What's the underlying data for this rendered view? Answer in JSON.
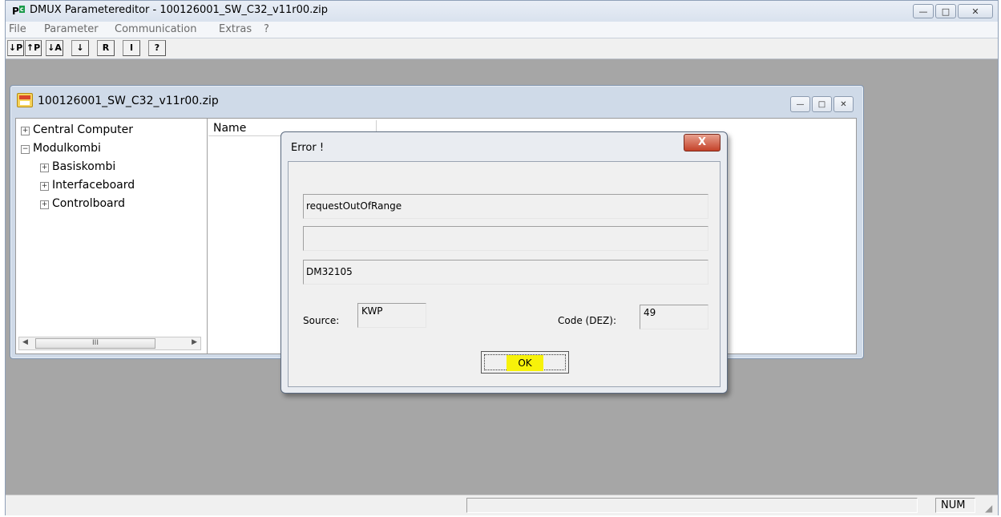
{
  "app": {
    "title": "DMUX Parametereditor - 100126001_SW_C32_v11r00.zip",
    "icon": "app-p-icon"
  },
  "window_buttons": {
    "minimize": "—",
    "maximize": "□",
    "close": "✕"
  },
  "menu": [
    "File",
    "Parameter",
    "Communication",
    "Extras",
    "?"
  ],
  "toolbar": [
    "↓P",
    "↑P",
    "↓A",
    "↓",
    "R",
    "I",
    "?"
  ],
  "document": {
    "title": "100126001_SW_C32_v11r00.zip",
    "tree": [
      {
        "label": "Central Computer",
        "expander": "+",
        "level": 0
      },
      {
        "label": "Modulkombi",
        "expander": "−",
        "level": 0
      },
      {
        "label": "Basiskombi",
        "expander": "+",
        "level": 1
      },
      {
        "label": "Interfaceboard",
        "expander": "+",
        "level": 1
      },
      {
        "label": "Controlboard",
        "expander": "+",
        "level": 1
      }
    ],
    "list_header": "Name",
    "scroll_thumb": "III"
  },
  "dialog": {
    "title": "Error !",
    "close_label": "X",
    "message": "requestOutOfRange",
    "message2": "",
    "code_id": "DM32105",
    "source_label": "Source:",
    "source_value": "KWP",
    "code_label": "Code (DEZ):",
    "code_value": "49",
    "ok_label": "OK"
  },
  "status": {
    "num": "NUM"
  },
  "colors": {
    "mdi_bg": "#a6a6a6",
    "ok_highlight": "#f7f20a",
    "dialog_close": "#c4422a"
  }
}
